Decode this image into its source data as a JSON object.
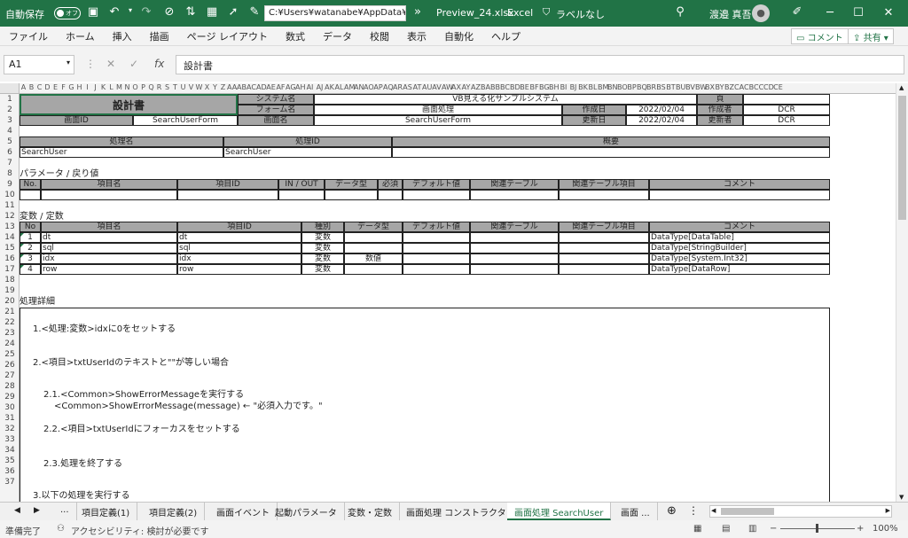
{
  "titlebar": {
    "autosave_label": "自動保存",
    "autosave_state": "オフ",
    "path": "C:¥Users¥watanabe¥AppData¥",
    "filename": "Preview_24.xlsx",
    "app": "Excel",
    "label_status": "ラベルなし",
    "user": "渡邉 真吾"
  },
  "ribbon": {
    "tabs": [
      "ファイル",
      "ホーム",
      "挿入",
      "描画",
      "ページ レイアウト",
      "数式",
      "データ",
      "校閲",
      "表示",
      "自動化",
      "ヘルプ"
    ],
    "comment_button": "コメント",
    "share_button": "共有"
  },
  "formula_bar": {
    "name_box": "A1",
    "content": "設計書"
  },
  "columns": [
    "A",
    "B",
    "C",
    "D",
    "E",
    "F",
    "G",
    "H",
    "I",
    "J",
    "K",
    "L",
    "M",
    "N",
    "O",
    "P",
    "Q",
    "R",
    "S",
    "T",
    "U",
    "V",
    "W",
    "X",
    "Y",
    "Z",
    "AA",
    "AB",
    "AC",
    "AD",
    "AE",
    "AF",
    "AG",
    "AH",
    "AI",
    "AJ",
    "AK",
    "AL",
    "AM",
    "AN",
    "AO",
    "AP",
    "AQ",
    "AR",
    "AS",
    "AT",
    "AU",
    "AV",
    "AW",
    "AX",
    "AY",
    "AZ",
    "BA",
    "BB",
    "BC",
    "BD",
    "BE",
    "BF",
    "BG",
    "BH",
    "BI",
    "BJ",
    "BK",
    "BL",
    "BM",
    "BN",
    "BO",
    "BP",
    "BQ",
    "BR",
    "BS",
    "BT",
    "BU",
    "BV",
    "BW",
    "BX",
    "BY",
    "BZ",
    "CA",
    "CB",
    "CC",
    "CD",
    "CE"
  ],
  "rows": [
    "1",
    "2",
    "3",
    "4",
    "5",
    "6",
    "7",
    "8",
    "9",
    "10",
    "11",
    "12",
    "13",
    "14",
    "15",
    "16",
    "17",
    "18",
    "19",
    "20",
    "21",
    "22",
    "23",
    "24",
    "25",
    "26",
    "27",
    "28",
    "29",
    "30",
    "31",
    "32",
    "33",
    "34",
    "35",
    "36",
    "37"
  ],
  "header": {
    "title": "設計書",
    "system_label": "システム名",
    "system_value": "VB見える化サンプルシステム",
    "page_label": "頁",
    "form_label": "フォーム名",
    "form_value": "画面処理",
    "created_label": "作成日",
    "created_value": "2022/02/04",
    "author_label": "作成者",
    "author_value": "DCR",
    "screen_id_label": "画面ID",
    "screen_id_value": "SearchUserForm",
    "screen_name_label": "画面名",
    "screen_name_value": "SearchUserForm",
    "updated_label": "更新日",
    "updated_value": "2022/02/04",
    "updater_label": "更新者",
    "updater_value": "DCR"
  },
  "process": {
    "name_label": "処理名",
    "id_label": "処理ID",
    "summary_label": "概要",
    "name_value": "SearchUser",
    "id_value": "SearchUser"
  },
  "params": {
    "section_title": "パラメータ / 戻り値",
    "headers": [
      "No.",
      "項目名",
      "項目ID",
      "IN / OUT",
      "データ型",
      "必須",
      "デフォルト値",
      "関連テーブル",
      "関連テーブル項目",
      "コメント"
    ]
  },
  "vars": {
    "section_title": "変数 / 定数",
    "headers": [
      "No",
      "項目名",
      "項目ID",
      "種別",
      "データ型",
      "デフォルト値",
      "関連テーブル",
      "関連テーブル項目",
      "コメント"
    ],
    "rows": [
      {
        "no": "1",
        "name": "dt",
        "id": "dt",
        "kind": "変数",
        "type": "",
        "comment": "DataType[DataTable]"
      },
      {
        "no": "2",
        "name": "sql",
        "id": "sql",
        "kind": "変数",
        "type": "",
        "comment": "DataType[StringBuilder]"
      },
      {
        "no": "3",
        "name": "idx",
        "id": "idx",
        "kind": "変数",
        "type": "数値",
        "comment": "DataType[System.Int32]"
      },
      {
        "no": "4",
        "name": "row",
        "id": "row",
        "kind": "変数",
        "type": "",
        "comment": "DataType[DataRow]"
      }
    ]
  },
  "detail": {
    "section_title": "処理詳細",
    "lines": [
      "1.<処理:変数>idxに0をセットする",
      "2.<項目>txtUserIdのテキストと\"\"が等しい場合",
      "2.1.<Common>ShowErrorMessageを実行する",
      "<Common>ShowErrorMessage(message) ← \"必須入力です。\"",
      "2.2.<項目>txtUserIdにフォーカスをセットする",
      "2.3.処理を終了する",
      "3.以下の処理を実行する"
    ]
  },
  "sheets": {
    "tabs": [
      "...",
      "項目定義(1)",
      "項目定義(2)",
      "画面イベント",
      "起動パラメータ",
      "変数・定数",
      "画面処理 コンストラクタ",
      "画面処理 SearchUser",
      "画面 ..."
    ],
    "active_index": 7
  },
  "status": {
    "ready": "準備完了",
    "accessibility": "アクセシビリティ: 検討が必要です",
    "zoom": "100%"
  }
}
